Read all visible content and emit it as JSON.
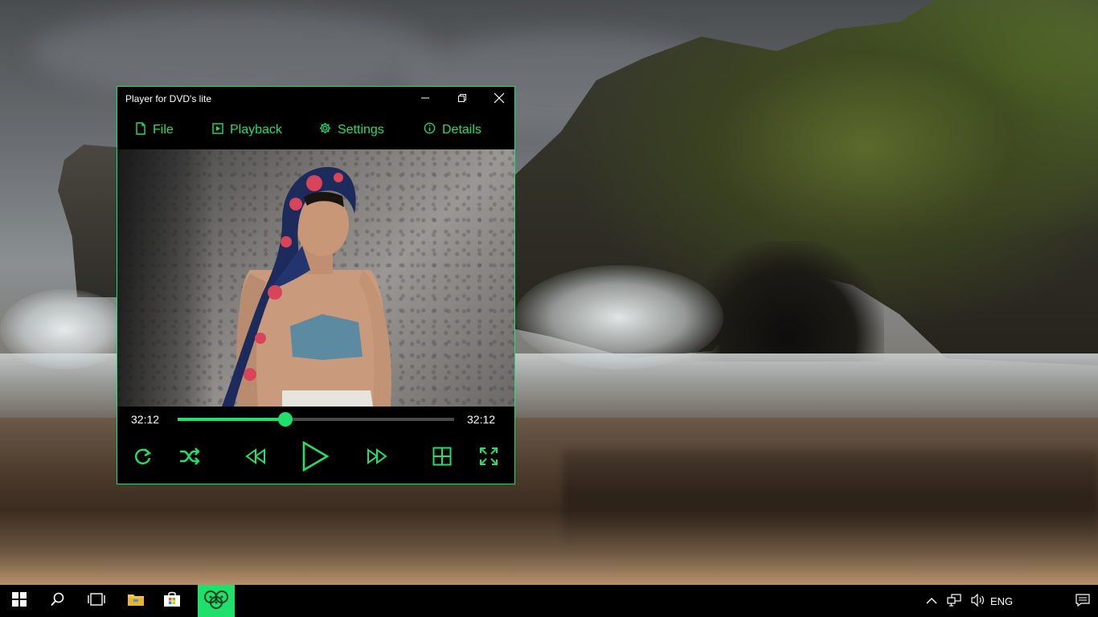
{
  "window": {
    "title": "Player for DVD's lite",
    "controls": {
      "minimize_icon": "minimize-icon",
      "maximize_icon": "restore-icon",
      "close_icon": "close-icon"
    }
  },
  "menu": {
    "items": [
      {
        "label": "File",
        "icon": "file-icon"
      },
      {
        "label": "Playback",
        "icon": "playback-icon"
      },
      {
        "label": "Settings",
        "icon": "gear-icon"
      },
      {
        "label": "Details",
        "icon": "info-icon"
      }
    ]
  },
  "playback": {
    "elapsed": "32:12",
    "total": "32:12",
    "progress_fraction": 0.39
  },
  "controls": {
    "items": [
      "repeat-icon",
      "shuffle-icon",
      "rewind-icon",
      "play-icon",
      "fast-forward-icon",
      "grid-icon",
      "fullscreen-icon"
    ]
  },
  "taskbar": {
    "items": [
      "start-icon",
      "search-icon",
      "task-view-icon",
      "file-explorer-icon",
      "store-icon",
      "player-app-icon"
    ],
    "tray": {
      "language": "ENG",
      "icons": [
        "chevron-up-icon",
        "network-icon",
        "volume-icon",
        "notifications-icon"
      ]
    }
  },
  "colors": {
    "accent": "#1ee06a",
    "window_bg": "#000000",
    "taskbar_bg": "#000000",
    "text": "#ffffff"
  }
}
